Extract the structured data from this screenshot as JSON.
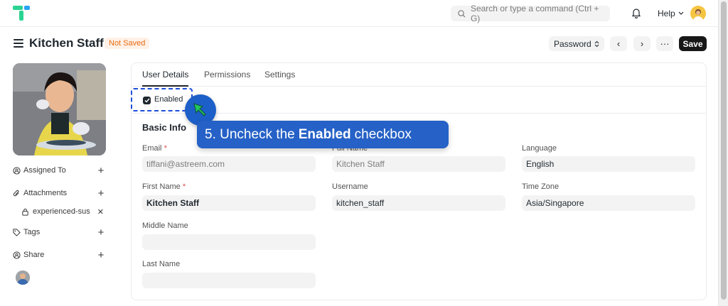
{
  "topbar": {
    "search_placeholder": "Search or type a command (Ctrl + G)",
    "help_label": "Help"
  },
  "page": {
    "title": "Kitchen Staff",
    "status": "Not Saved"
  },
  "actions": {
    "select_label": "Password",
    "prev": "‹",
    "next": "›",
    "more": "···",
    "save_label": "Save"
  },
  "sidebar": {
    "assigned_to": "Assigned To",
    "attachments": "Attachments",
    "attachment_file": "experienced-sus",
    "tags": "Tags",
    "share": "Share"
  },
  "tabs": [
    {
      "label": "User Details"
    },
    {
      "label": "Permissions"
    },
    {
      "label": "Settings"
    }
  ],
  "form": {
    "enabled_label": "Enabled",
    "enabled_checked": true,
    "section_title": "Basic Info",
    "fields": {
      "email": {
        "label": "Email",
        "value": "tiffani@astreem.com"
      },
      "full_name": {
        "label": "Full Name",
        "value": "Kitchen Staff"
      },
      "language": {
        "label": "Language",
        "value": "English"
      },
      "first_name": {
        "label": "First Name",
        "value": "Kitchen Staff"
      },
      "username": {
        "label": "Username",
        "value": "kitchen_staff"
      },
      "time_zone": {
        "label": "Time Zone",
        "value": "Asia/Singapore"
      },
      "middle_name": {
        "label": "Middle Name",
        "value": ""
      },
      "last_name": {
        "label": "Last Name",
        "value": ""
      }
    },
    "required_mark": "*"
  },
  "callout": {
    "prefix": "5. Uncheck the",
    "bold": "Enabled",
    "suffix": "checkbox"
  },
  "colors": {
    "accent": "#2561c6",
    "status_text": "#e86c13",
    "status_bg": "#fff1e7",
    "cursor_green": "#22c55e"
  },
  "icons": [
    "logo-icon",
    "search-icon",
    "bell-icon",
    "chevron-down-icon",
    "menu-icon",
    "user-check-icon",
    "paperclip-icon",
    "lock-icon",
    "close-icon",
    "tag-icon",
    "share-icon",
    "plus-icon",
    "check-icon",
    "cursor-arrow-icon"
  ]
}
